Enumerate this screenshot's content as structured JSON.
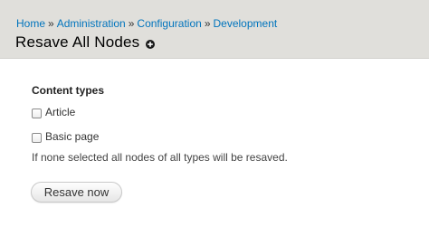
{
  "breadcrumb": {
    "items": [
      "Home",
      "Administration",
      "Configuration",
      "Development"
    ],
    "separator": "»"
  },
  "page": {
    "title": "Resave All Nodes",
    "shortcut_icon": "plus-circle-icon"
  },
  "form": {
    "fieldset_title": "Content types",
    "options": [
      {
        "label": "Article",
        "checked": false
      },
      {
        "label": "Basic page",
        "checked": false
      }
    ],
    "description": "If none selected all nodes of all types will be resaved.",
    "submit_label": "Resave now"
  },
  "colors": {
    "link": "#0074bd",
    "header_bg": "#e0dfdb"
  }
}
